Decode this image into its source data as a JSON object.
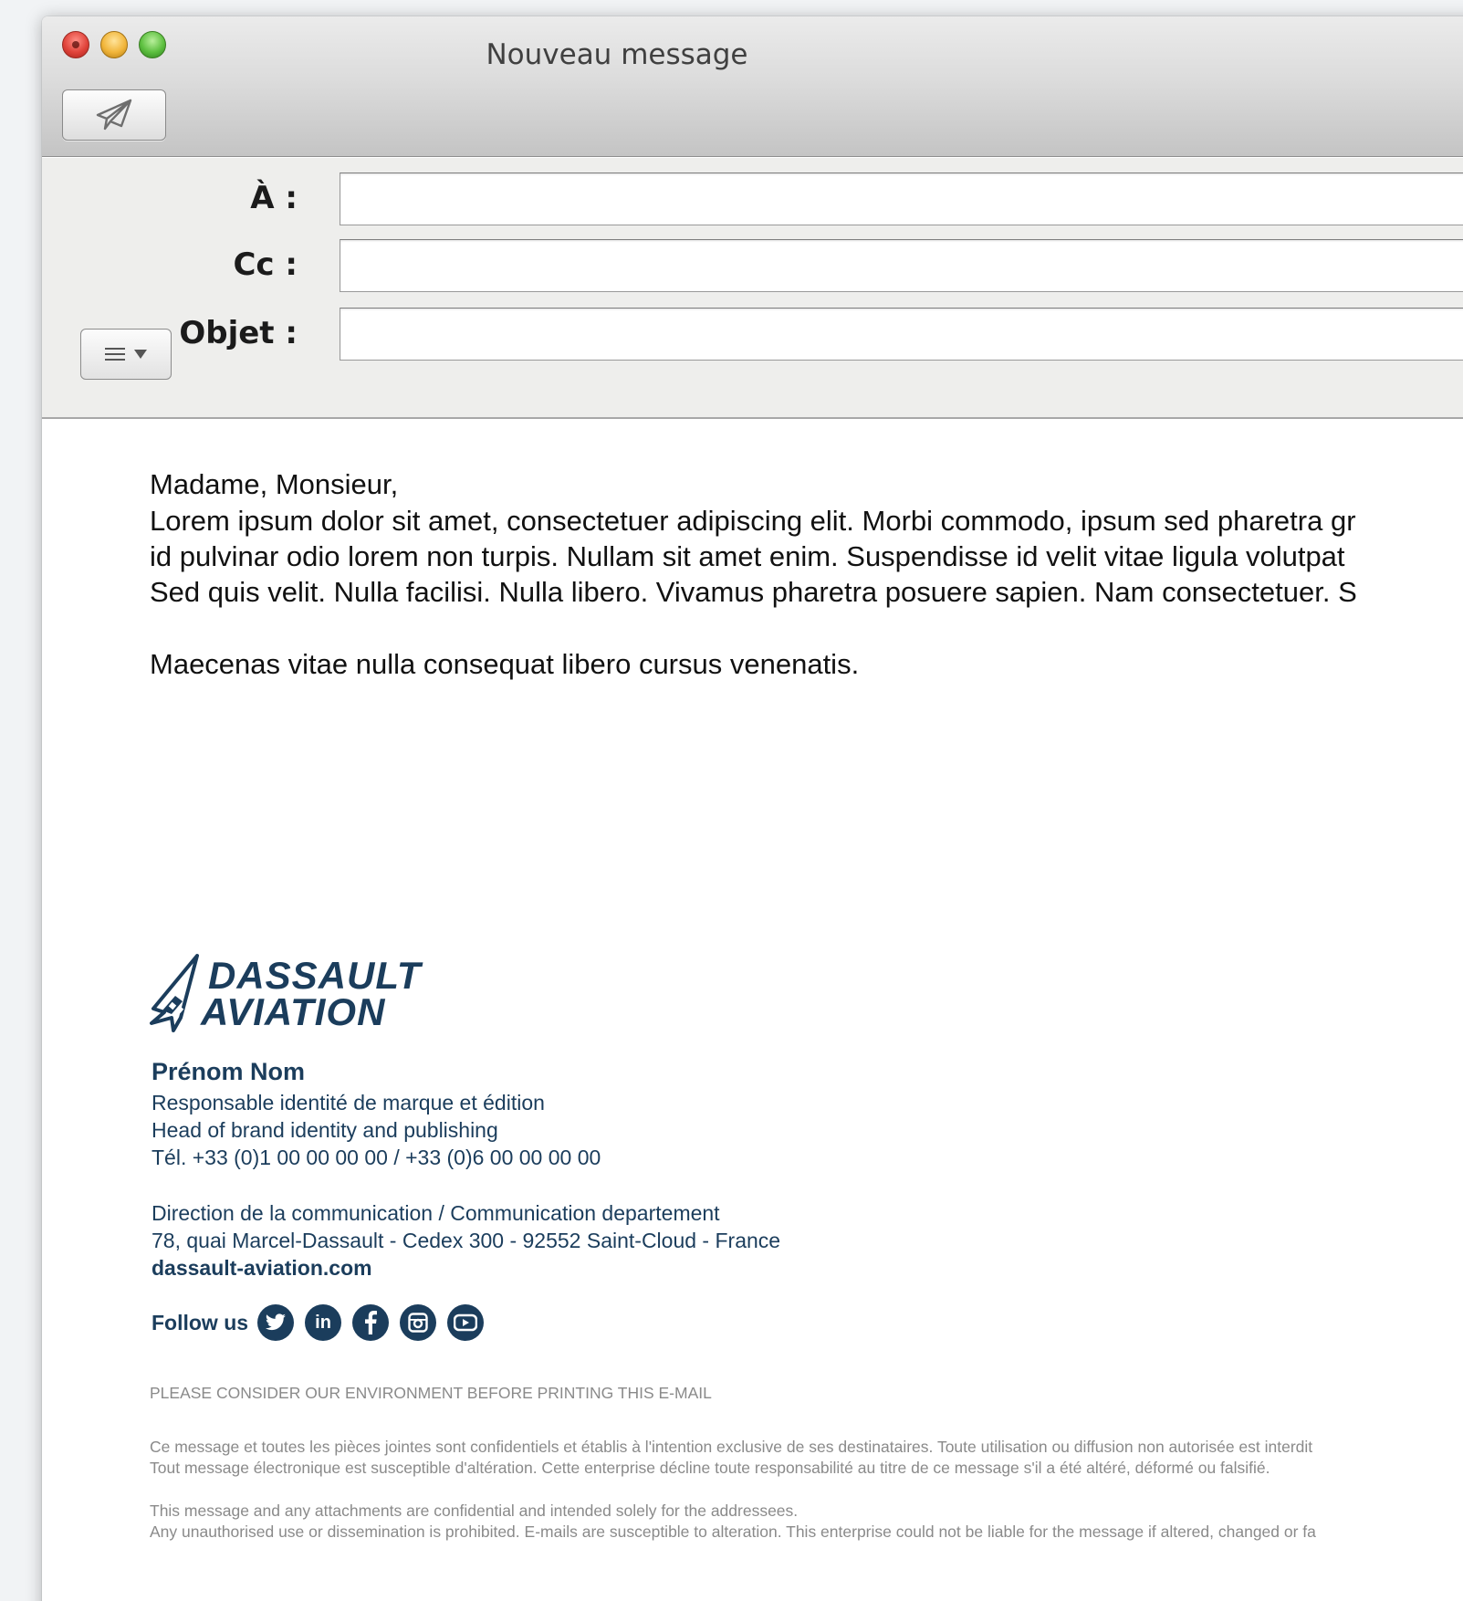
{
  "window": {
    "title": "Nouveau message"
  },
  "toolbar": {
    "send_icon": "paper-plane-icon"
  },
  "fields": {
    "to_label": "À :",
    "to_value": "",
    "cc_label": "Cc :",
    "cc_value": "",
    "subject_label": "Objet :",
    "subject_value": ""
  },
  "format_menu": {
    "icon": "list-icon",
    "chevron": "chevron-down-icon"
  },
  "message": {
    "greeting": "Madame, Monsieur,",
    "lines": [
      "Lorem ipsum dolor sit amet, consectetuer adipiscing elit. Morbi commodo, ipsum sed pharetra gr",
      "id pulvinar odio lorem non turpis. Nullam sit amet enim. Suspendisse id velit vitae ligula volutpat",
      "Sed quis velit. Nulla facilisi. Nulla libero. Vivamus pharetra posuere sapien. Nam consectetuer. S"
    ],
    "closing": "Maecenas vitae nulla consequat libero cursus venenatis."
  },
  "signature": {
    "logo_line1": "DASSAULT",
    "logo_line2": "AVIATION",
    "name": "Prénom Nom",
    "title_fr": "Responsable identité de marque et édition",
    "title_en": "Head of brand identity and publishing",
    "phone": "Tél. +33 (0)1 00 00 00 00 / +33 (0)6  00 00 00 00",
    "department": "Direction de la communication / Communication departement",
    "address": "78, quai Marcel-Dassault - Cedex 300 - 92552 Saint-Cloud - France",
    "website": "dassault-aviation.com",
    "follow_label": "Follow us",
    "social_icons": [
      "twitter-icon",
      "linkedin-icon",
      "facebook-icon",
      "instagram-icon",
      "youtube-icon"
    ],
    "brand_color": "#1b3d5c"
  },
  "disclaimer": {
    "environment": "PLEASE CONSIDER OUR ENVIRONMENT BEFORE PRINTING THIS E-MAIL",
    "fr_line1": "Ce message et toutes les pièces jointes sont confidentiels et établis à l'intention exclusive de ses destinataires. Toute utilisation ou diffusion non autorisée est interdit",
    "fr_line2": "Tout message électronique est susceptible d'altération. Cette enterprise décline toute responsabilité au titre de ce message s'il a été altéré, déformé ou falsifié.",
    "en_line1": "This message and any attachments are confidential and intended solely for the addressees.",
    "en_line2": "Any unauthorised use or dissemination is prohibited. E-mails are susceptible to alteration. This enterprise could not be liable for the message if altered, changed or fa"
  }
}
